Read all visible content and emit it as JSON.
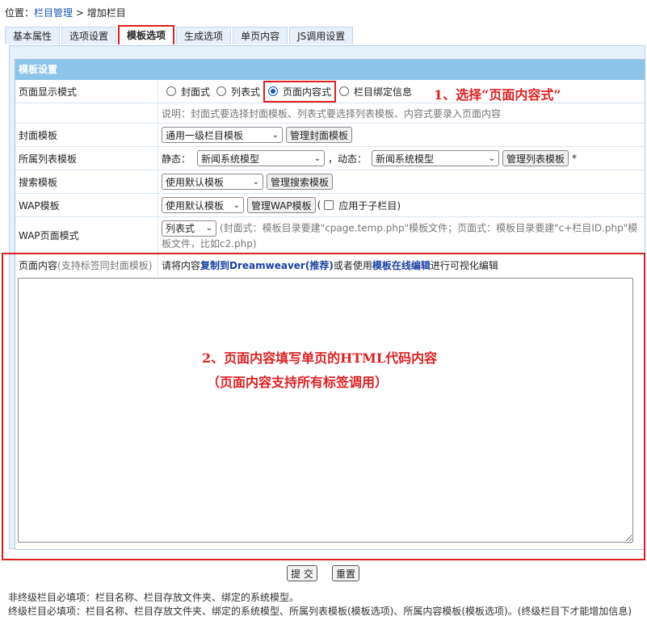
{
  "breadcrumb": {
    "prefix": "位置：",
    "link": "栏目管理",
    "sep": " > ",
    "current": "增加栏目"
  },
  "tabs": [
    {
      "label": "基本属性"
    },
    {
      "label": "选项设置"
    },
    {
      "label": "模板选项"
    },
    {
      "label": "生成选项"
    },
    {
      "label": "单页内容"
    },
    {
      "label": "JS调用设置"
    }
  ],
  "section_header": "模板设置",
  "display_mode": {
    "label": "页面显示模式",
    "options": [
      "封面式",
      "列表式",
      "页面内容式",
      "栏目绑定信息"
    ],
    "selected": "页面内容式",
    "note": "说明：封面式要选择封面模板、列表式要选择列表模板、内容式要录入页面内容"
  },
  "cover_template": {
    "label": "封面模板",
    "select": "通用一级栏目模板",
    "button": "管理封面模板"
  },
  "list_template": {
    "label": "所属列表模板",
    "static_label": "静态：",
    "static_select": "新闻系统模型",
    "dynamic_label": "，动态：",
    "dynamic_select": "新闻系统模型",
    "button": "管理列表模板",
    "required": "*"
  },
  "search_template": {
    "label": "搜索模板",
    "select": "使用默认模板",
    "button": "管理搜索模板"
  },
  "wap_template": {
    "label": "WAP模板",
    "select": "使用默认模板",
    "button": "管理WAP模板",
    "paren_open": "(",
    "checkbox_label": "应用于子栏目)"
  },
  "wap_mode": {
    "label": "WAP页面模式",
    "select": "列表式",
    "desc_1": "(封面式：模板目录要建\"cpage.temp.php\"模板文件；页面式：模板目录要建\"c+栏目ID.php\"模",
    "desc_2": "板文件，比如c2.php)"
  },
  "page_content": {
    "label": "页面内容",
    "label_hint": "(支持标签同封面模板)",
    "hint_1": "请将内容",
    "hint_link1": "复制到Dreamweaver(推荐)",
    "hint_2": "或者使用",
    "hint_link2": "模板在线编辑",
    "hint_3": "进行可视化编辑",
    "textarea_value": ""
  },
  "annotations": {
    "step1": "1、选择“页面内容式”",
    "step2": "2、页面内容填写单页的HTML代码内容",
    "step2_sub": "（页面内容支持所有标签调用）"
  },
  "buttons": {
    "submit": "提 交",
    "reset": "重置"
  },
  "footer": {
    "line1": "非终级栏目必填项：栏目名称、栏目存放文件夹、绑定的系统模型。",
    "line2": "终级栏目必填项：栏目名称、栏目存放文件夹、绑定的系统模型、所属列表模板(模板选项)、所属内容模板(模板选项)。(终级栏目下才能增加信息)"
  },
  "colors": {
    "accent": "#1a56b5",
    "annotation": "#e02020",
    "header_bg": "#8dc4ea"
  }
}
